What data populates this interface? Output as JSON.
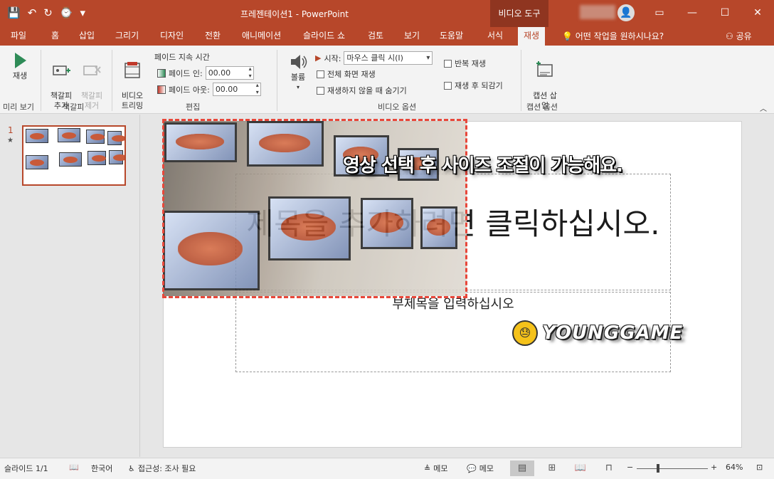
{
  "window": {
    "doc_title": "프레젠테이션1  -  PowerPoint",
    "tool_tab": "비디오 도구",
    "controls": [
      "▭",
      "—",
      "☐",
      "✕"
    ]
  },
  "qat": [
    "💾",
    "↶",
    "↻",
    "⌚",
    "▾"
  ],
  "tabs": [
    "파일",
    "홈",
    "삽입",
    "그리기",
    "디자인",
    "전환",
    "애니메이션",
    "슬라이드 쇼",
    "검토",
    "보기",
    "도움말",
    "서식",
    "재생"
  ],
  "tell_me": "어떤 작업을 원하시나요?",
  "share": "공유",
  "ribbon": {
    "preview": {
      "play": "재생",
      "group": "미리 보기"
    },
    "bookmark": {
      "add": "책갈피\n추가",
      "remove": "책갈피\n제거",
      "group": "책갈피"
    },
    "edit": {
      "trim": "비디오\n트리밍",
      "fade_duration": "페이드 지속 시간",
      "fade_in_label": "페이드 인:",
      "fade_in_value": "00.00",
      "fade_out_label": "페이드 아웃:",
      "fade_out_value": "00.00",
      "group": "편집"
    },
    "video_options": {
      "volume": "볼륨",
      "start_label": "시작:",
      "start_value": "마우스 클릭 시(I)",
      "fullscreen": "전체 화면 재생",
      "hide": "재생하지 않을 때 숨기기",
      "loop": "반복 재생",
      "rewind": "재생 후 되감기",
      "group": "비디오 옵션"
    },
    "captions": {
      "insert": "캡션 삽\n입",
      "group": "캡션 옵션"
    }
  },
  "thumbnail": {
    "number": "1",
    "star": "★"
  },
  "slide": {
    "title_placeholder": "제목을 추가하려면 클릭하십시오.",
    "subtitle_placeholder": "부제목을 입력하십시오",
    "overlay_caption": "영상 선택 후 사이즈 조절이 가능해요.",
    "watermark": "YOUNGGAME"
  },
  "statusbar": {
    "slide_count": "슬라이드 1/1",
    "language": "한국어",
    "accessibility": "접근성: 조사 필요",
    "notes1": "메모",
    "notes2": "메모",
    "zoom_minus": "−",
    "zoom_plus": "+",
    "zoom": "64%"
  },
  "colors": {
    "accent": "#b7472a",
    "selection": "#e8473a"
  },
  "zoom_fraction": 0.3
}
